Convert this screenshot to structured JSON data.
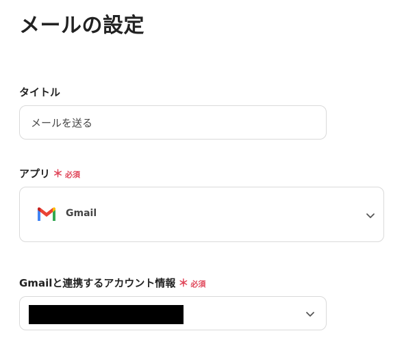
{
  "page": {
    "title": "メールの設定"
  },
  "fields": {
    "title_field": {
      "label": "タイトル",
      "value": "メールを送る"
    },
    "app_field": {
      "label": "アプリ",
      "required_mark": "＊",
      "required_text": "必須",
      "selected_app": "Gmail",
      "app_icon": "gmail-logo"
    },
    "account_field": {
      "label": "Gmailと連携するアカウント情報",
      "required_mark": "＊",
      "required_text": "必須",
      "dropdown_icon": "chevron-down-icon"
    }
  },
  "colors": {
    "required": "#e0475a",
    "border": "#d9d9d9",
    "text": "#222222"
  }
}
